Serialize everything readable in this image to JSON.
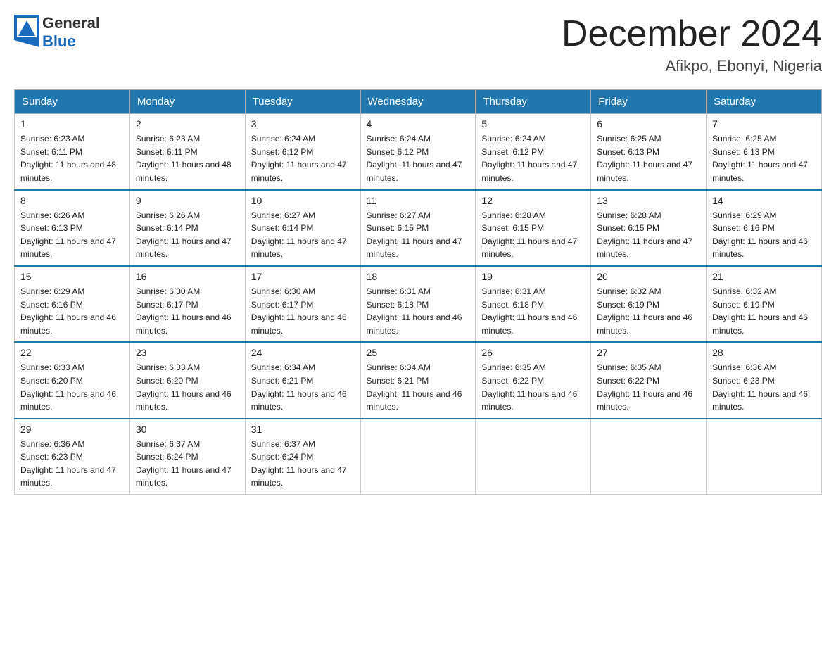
{
  "header": {
    "logo_text_general": "General",
    "logo_text_blue": "Blue",
    "month_title": "December 2024",
    "location": "Afikpo, Ebonyi, Nigeria"
  },
  "days_of_week": [
    "Sunday",
    "Monday",
    "Tuesday",
    "Wednesday",
    "Thursday",
    "Friday",
    "Saturday"
  ],
  "weeks": [
    [
      {
        "day": "1",
        "sunrise": "6:23 AM",
        "sunset": "6:11 PM",
        "daylight": "11 hours and 48 minutes."
      },
      {
        "day": "2",
        "sunrise": "6:23 AM",
        "sunset": "6:11 PM",
        "daylight": "11 hours and 48 minutes."
      },
      {
        "day": "3",
        "sunrise": "6:24 AM",
        "sunset": "6:12 PM",
        "daylight": "11 hours and 47 minutes."
      },
      {
        "day": "4",
        "sunrise": "6:24 AM",
        "sunset": "6:12 PM",
        "daylight": "11 hours and 47 minutes."
      },
      {
        "day": "5",
        "sunrise": "6:24 AM",
        "sunset": "6:12 PM",
        "daylight": "11 hours and 47 minutes."
      },
      {
        "day": "6",
        "sunrise": "6:25 AM",
        "sunset": "6:13 PM",
        "daylight": "11 hours and 47 minutes."
      },
      {
        "day": "7",
        "sunrise": "6:25 AM",
        "sunset": "6:13 PM",
        "daylight": "11 hours and 47 minutes."
      }
    ],
    [
      {
        "day": "8",
        "sunrise": "6:26 AM",
        "sunset": "6:13 PM",
        "daylight": "11 hours and 47 minutes."
      },
      {
        "day": "9",
        "sunrise": "6:26 AM",
        "sunset": "6:14 PM",
        "daylight": "11 hours and 47 minutes."
      },
      {
        "day": "10",
        "sunrise": "6:27 AM",
        "sunset": "6:14 PM",
        "daylight": "11 hours and 47 minutes."
      },
      {
        "day": "11",
        "sunrise": "6:27 AM",
        "sunset": "6:15 PM",
        "daylight": "11 hours and 47 minutes."
      },
      {
        "day": "12",
        "sunrise": "6:28 AM",
        "sunset": "6:15 PM",
        "daylight": "11 hours and 47 minutes."
      },
      {
        "day": "13",
        "sunrise": "6:28 AM",
        "sunset": "6:15 PM",
        "daylight": "11 hours and 47 minutes."
      },
      {
        "day": "14",
        "sunrise": "6:29 AM",
        "sunset": "6:16 PM",
        "daylight": "11 hours and 46 minutes."
      }
    ],
    [
      {
        "day": "15",
        "sunrise": "6:29 AM",
        "sunset": "6:16 PM",
        "daylight": "11 hours and 46 minutes."
      },
      {
        "day": "16",
        "sunrise": "6:30 AM",
        "sunset": "6:17 PM",
        "daylight": "11 hours and 46 minutes."
      },
      {
        "day": "17",
        "sunrise": "6:30 AM",
        "sunset": "6:17 PM",
        "daylight": "11 hours and 46 minutes."
      },
      {
        "day": "18",
        "sunrise": "6:31 AM",
        "sunset": "6:18 PM",
        "daylight": "11 hours and 46 minutes."
      },
      {
        "day": "19",
        "sunrise": "6:31 AM",
        "sunset": "6:18 PM",
        "daylight": "11 hours and 46 minutes."
      },
      {
        "day": "20",
        "sunrise": "6:32 AM",
        "sunset": "6:19 PM",
        "daylight": "11 hours and 46 minutes."
      },
      {
        "day": "21",
        "sunrise": "6:32 AM",
        "sunset": "6:19 PM",
        "daylight": "11 hours and 46 minutes."
      }
    ],
    [
      {
        "day": "22",
        "sunrise": "6:33 AM",
        "sunset": "6:20 PM",
        "daylight": "11 hours and 46 minutes."
      },
      {
        "day": "23",
        "sunrise": "6:33 AM",
        "sunset": "6:20 PM",
        "daylight": "11 hours and 46 minutes."
      },
      {
        "day": "24",
        "sunrise": "6:34 AM",
        "sunset": "6:21 PM",
        "daylight": "11 hours and 46 minutes."
      },
      {
        "day": "25",
        "sunrise": "6:34 AM",
        "sunset": "6:21 PM",
        "daylight": "11 hours and 46 minutes."
      },
      {
        "day": "26",
        "sunrise": "6:35 AM",
        "sunset": "6:22 PM",
        "daylight": "11 hours and 46 minutes."
      },
      {
        "day": "27",
        "sunrise": "6:35 AM",
        "sunset": "6:22 PM",
        "daylight": "11 hours and 46 minutes."
      },
      {
        "day": "28",
        "sunrise": "6:36 AM",
        "sunset": "6:23 PM",
        "daylight": "11 hours and 46 minutes."
      }
    ],
    [
      {
        "day": "29",
        "sunrise": "6:36 AM",
        "sunset": "6:23 PM",
        "daylight": "11 hours and 47 minutes."
      },
      {
        "day": "30",
        "sunrise": "6:37 AM",
        "sunset": "6:24 PM",
        "daylight": "11 hours and 47 minutes."
      },
      {
        "day": "31",
        "sunrise": "6:37 AM",
        "sunset": "6:24 PM",
        "daylight": "11 hours and 47 minutes."
      },
      null,
      null,
      null,
      null
    ]
  ]
}
